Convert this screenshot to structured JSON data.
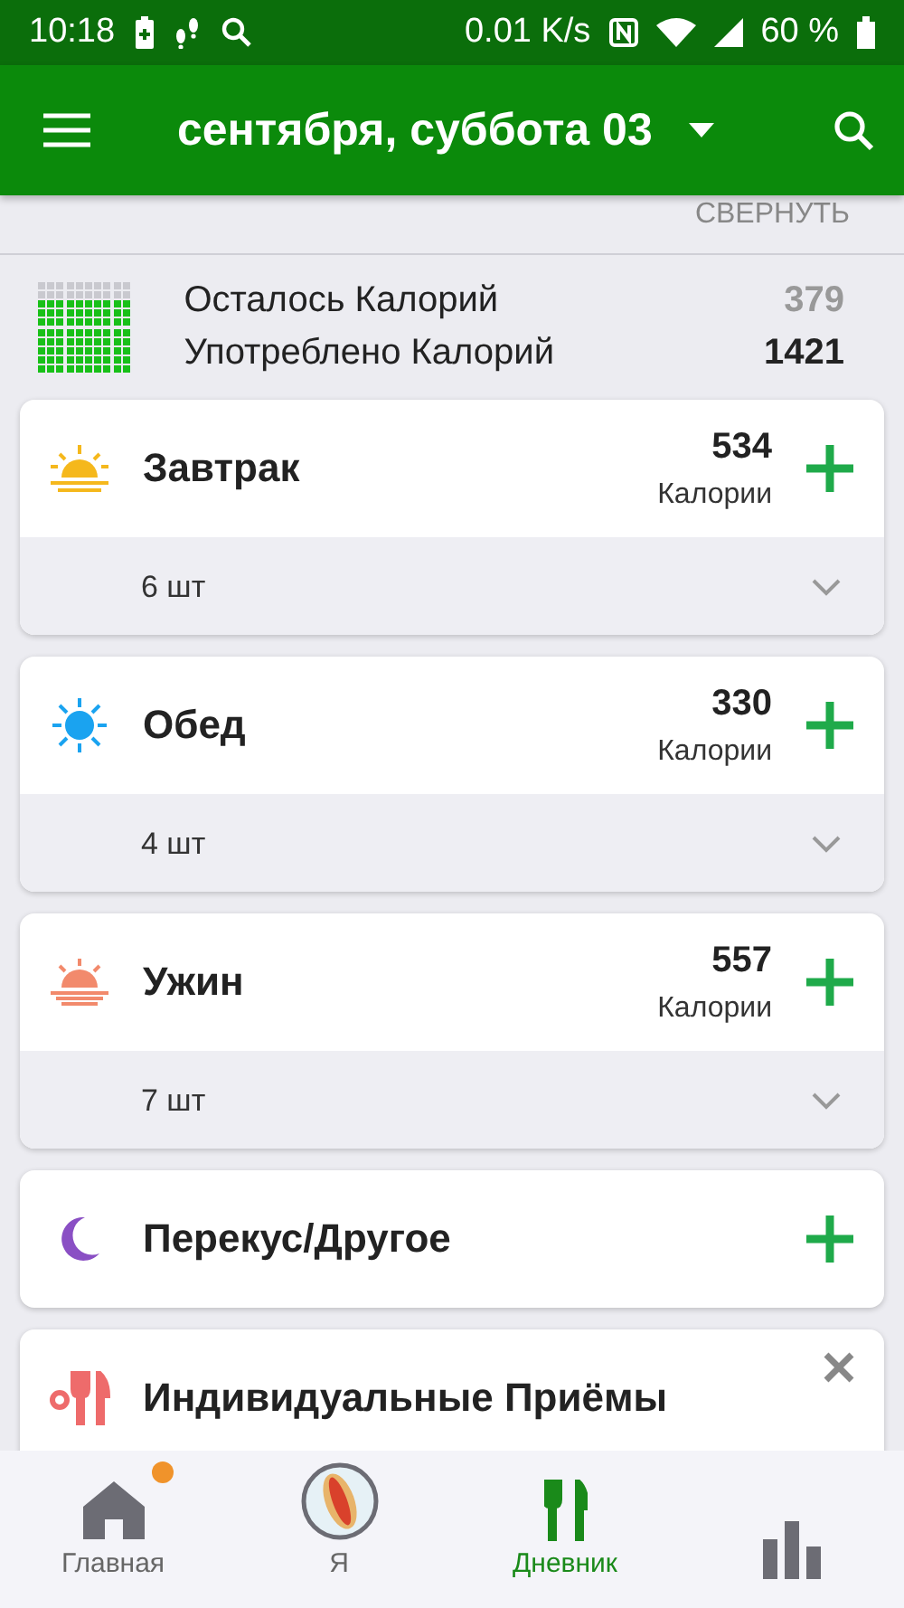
{
  "status_bar": {
    "time": "10:18",
    "speed": "0.01 K/s",
    "battery": "60 %"
  },
  "app_bar": {
    "title": "сентября, суббота 03"
  },
  "collapse": {
    "label": "СВЕРНУТЬ"
  },
  "summary": {
    "rows": [
      {
        "label": "Осталось Калорий",
        "value": "379",
        "kind": "remaining"
      },
      {
        "label": "Употреблено Калорий",
        "value": "1421",
        "kind": "consumed"
      }
    ]
  },
  "meals": [
    {
      "kind": "meal",
      "name": "Завтрак",
      "calories": "534",
      "unit": "Калории",
      "count": "6 шт"
    },
    {
      "kind": "meal",
      "name": "Обед",
      "calories": "330",
      "unit": "Калории",
      "count": "4 шт"
    },
    {
      "kind": "meal",
      "name": "Ужин",
      "calories": "557",
      "unit": "Калории",
      "count": "7 шт"
    },
    {
      "kind": "simple",
      "name": "Перекус/Другое"
    },
    {
      "kind": "custom",
      "name": "Индивидуальные Приёмы"
    }
  ],
  "bottom_nav": [
    {
      "label": "Главная",
      "selected": false,
      "notification": true
    },
    {
      "label": "Я",
      "selected": false,
      "notification": false
    },
    {
      "label": "Дневник",
      "selected": true,
      "notification": false
    },
    {
      "selected": false,
      "notification": false
    }
  ]
}
